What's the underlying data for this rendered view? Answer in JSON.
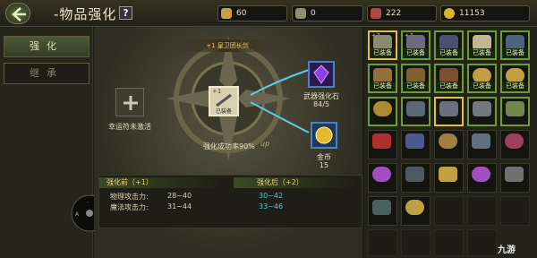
{
  "header": {
    "title": "-物品强化",
    "help_label": "?",
    "resources": [
      {
        "icon": "gold-ingot-icon",
        "value": "60"
      },
      {
        "icon": "crystal-icon",
        "value": "0"
      },
      {
        "icon": "gem-icon",
        "value": "222"
      },
      {
        "icon": "coin-icon",
        "value": "11153"
      }
    ]
  },
  "sidebar": {
    "items": [
      {
        "label": "强化",
        "active": true
      },
      {
        "label": "继承",
        "active": false
      }
    ]
  },
  "enhance": {
    "item_banner": "+1 皇卫团长剑",
    "lucky_label": "幸运符未激活",
    "center_item_tag": "已装备",
    "center_item_plus": "+1",
    "material1_name": "武器强化石",
    "material1_count": "84/5",
    "material2_name": "金币",
    "material2_count": "15",
    "success_rate": "强化成功率90%",
    "up_label": "up"
  },
  "stats": {
    "before_title": "强化前（+1）",
    "after_title": "强化后（+2）",
    "rows": [
      {
        "label": "物理攻击力:",
        "before": "28~40",
        "after": "30~42"
      },
      {
        "label": "魔法攻击力:",
        "before": "31~44",
        "after": "33~46"
      }
    ]
  },
  "inventory": {
    "equipped_tag": "已装备",
    "colors": {
      "equipped_border": "#6b9a3a",
      "highlight_border": "#e0c040"
    }
  },
  "watermark": "九游"
}
